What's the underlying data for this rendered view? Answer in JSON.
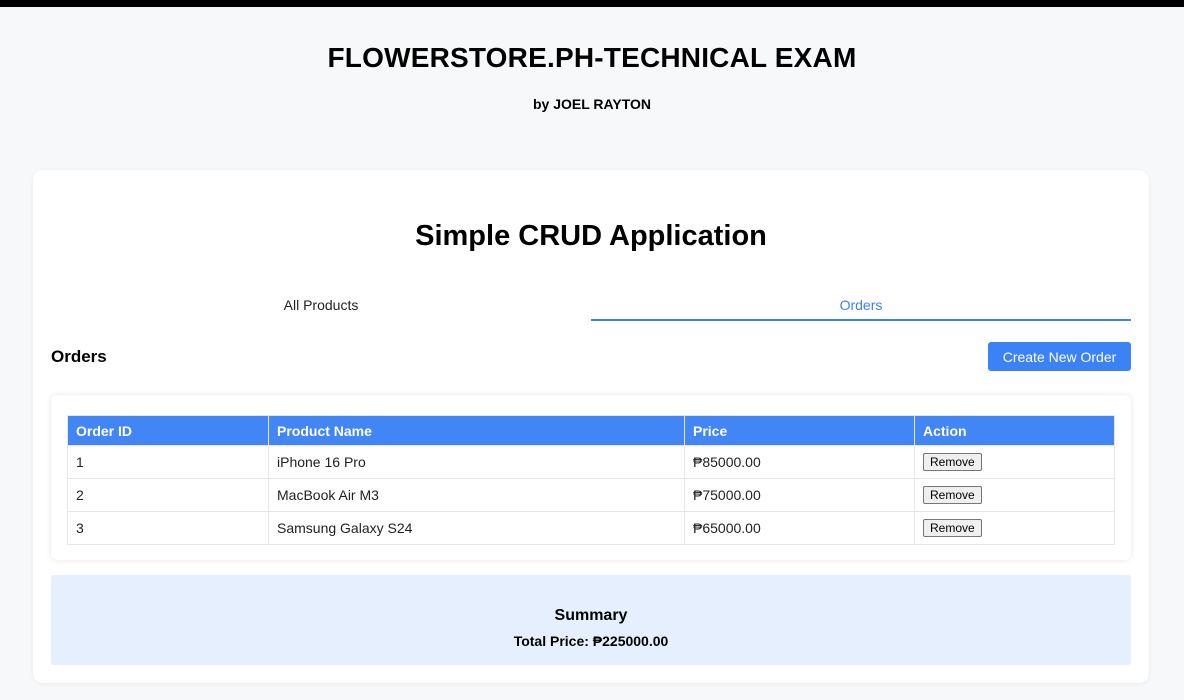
{
  "header": {
    "title": "FLOWERSTORE.PH-TECHNICAL EXAM",
    "byline": "by JOEL RAYTON"
  },
  "app": {
    "title": "Simple CRUD Application",
    "tabs": [
      {
        "label": "All Products",
        "active": false
      },
      {
        "label": "Orders",
        "active": true
      }
    ]
  },
  "orders": {
    "heading": "Orders",
    "create_button": "Create New Order",
    "columns": [
      "Order ID",
      "Product Name",
      "Price",
      "Action"
    ],
    "rows": [
      {
        "id": "1",
        "name": "iPhone 16 Pro",
        "price": "₱85000.00",
        "action": "Remove"
      },
      {
        "id": "2",
        "name": "MacBook Air M3",
        "price": "₱75000.00",
        "action": "Remove"
      },
      {
        "id": "3",
        "name": "Samsung Galaxy S24",
        "price": "₱65000.00",
        "action": "Remove"
      }
    ]
  },
  "summary": {
    "title": "Summary",
    "total": "Total Price: ₱225000.00"
  },
  "colors": {
    "accent": "#3b82f6",
    "table_header": "#4285f4",
    "summary_bg": "#e6effd"
  }
}
